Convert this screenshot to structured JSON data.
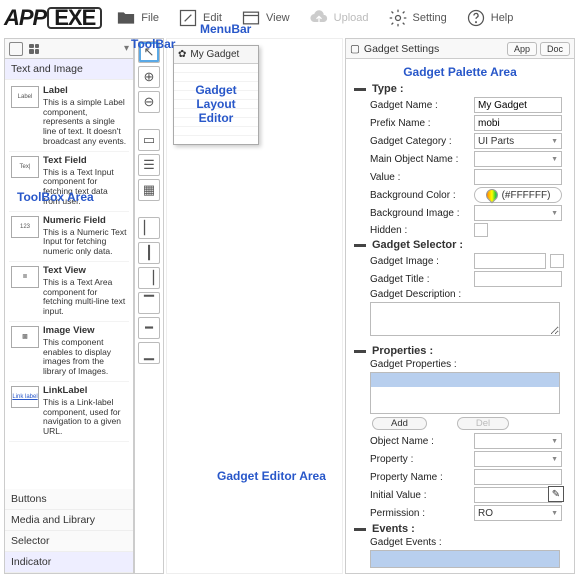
{
  "app": {
    "logo_left": "APP",
    "logo_box": "EXE"
  },
  "menubar": {
    "file": "File",
    "edit": "Edit",
    "view": "View",
    "upload": "Upload",
    "setting": "Setting",
    "help": "Help"
  },
  "annotations": {
    "menubar": "MenuBar",
    "toolbar": "ToolBar",
    "toolbox": "ToolBox Area",
    "editor": "Gadget Editor Area",
    "palette": "Gadget Palette Area",
    "layout_editor": "Gadget Layout Editor"
  },
  "toolbox": {
    "header_category": "Text and Image",
    "items": [
      {
        "icon": "Label",
        "title": "Label",
        "desc": "This is a simple Label component, represents a single line of text. It doesn't broadcast any events."
      },
      {
        "icon": "Tex|",
        "title": "Text Field",
        "desc": "This is a Text Input component for fetching text data from user."
      },
      {
        "icon": "123",
        "title": "Numeric Field",
        "desc": "This is a Numeric Text Input for fetching numeric only data."
      },
      {
        "icon": "≣",
        "title": "Text View",
        "desc": "This is a Text Area component for fetching multi-line text input."
      },
      {
        "icon": "▩",
        "title": "Image View",
        "desc": "This component enables to display images from the library of Images."
      },
      {
        "icon": "Link label",
        "title": "LinkLabel",
        "desc": "This is a Link-label component, used for navigation to a given URL."
      }
    ],
    "bottom_categories": [
      "Buttons",
      "Media and Library",
      "Selector",
      "Indicator"
    ]
  },
  "canvas": {
    "title": "My Gadget"
  },
  "settings": {
    "panel_title": "Gadget Settings",
    "buttons": {
      "app": "App",
      "doc": "Doc"
    },
    "type": {
      "section": "Type :",
      "gadget_name_label": "Gadget Name :",
      "gadget_name_value": "My Gadget",
      "prefix_label": "Prefix Name :",
      "prefix_value": "mobi",
      "category_label": "Gadget Category :",
      "category_value": "UI Parts",
      "main_obj_label": "Main Object Name :",
      "main_obj_value": "",
      "value_label": "Value :",
      "value_value": "",
      "bgcolor_label": "Background Color :",
      "bgcolor_value": "(#FFFFFF)",
      "bgimage_label": "Background Image :",
      "bgimage_value": "",
      "hidden_label": "Hidden :"
    },
    "selector": {
      "section": "Gadget Selector :",
      "image_label": "Gadget Image :",
      "title_label": "Gadget Title :",
      "desc_label": "Gadget Description :"
    },
    "props": {
      "section": "Properties :",
      "gadget_props_label": "Gadget Properties :",
      "add": "Add",
      "del": "Del",
      "object_label": "Object Name :",
      "property_label": "Property :",
      "propname_label": "Property Name :",
      "initial_label": "Initial Value :",
      "permission_label": "Permission :",
      "permission_value": "RO"
    },
    "events": {
      "section": "Events :",
      "gadget_events_label": "Gadget Events :"
    }
  }
}
